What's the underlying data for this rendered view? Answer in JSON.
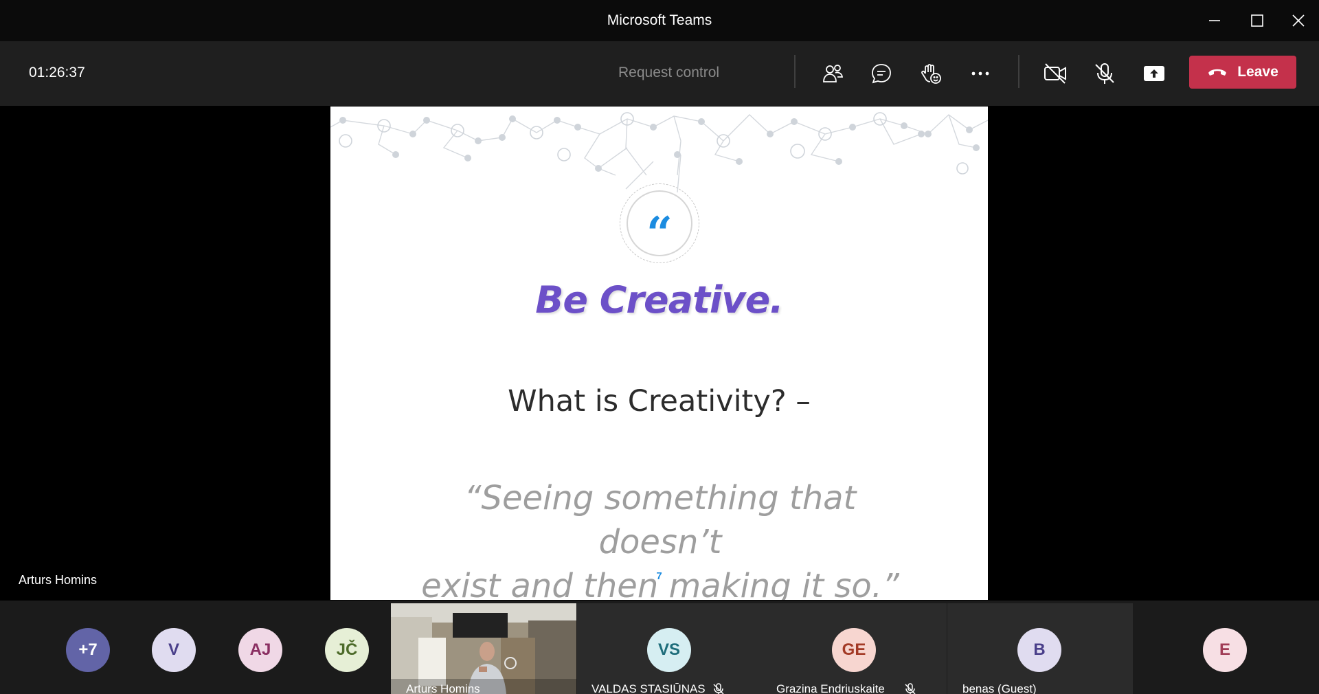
{
  "window": {
    "title": "Microsoft Teams"
  },
  "toolbar": {
    "timer": "01:26:37",
    "request_control_label": "Request control",
    "leave_label": "Leave"
  },
  "slide": {
    "quote_mark": "“",
    "heading": "Be Creative.",
    "subheading": "What is Creativity? –",
    "quote_line1": "“Seeing something that doesn’t",
    "quote_line2": "exist and then making it so.”",
    "page_number": "7"
  },
  "presenter": {
    "name": "Arturs Homins"
  },
  "participants": {
    "overflow": {
      "label": "+7",
      "bg": "#6264a7",
      "fg": "#ffffff"
    },
    "avatars": [
      {
        "initials": "V",
        "bg": "#e0dcf0",
        "fg": "#4a3f8a"
      },
      {
        "initials": "AJ",
        "bg": "#f0d8e6",
        "fg": "#8a2f62"
      },
      {
        "initials": "JČ",
        "bg": "#e6efd6",
        "fg": "#4d6b2a"
      }
    ],
    "video": {
      "name": "Arturs Homins"
    },
    "tiles": [
      {
        "initials": "VS",
        "name": "VALDAS STASIŪNAS",
        "muted": true,
        "bg": "#d6eef2",
        "fg": "#1d6c7a"
      },
      {
        "initials": "GE",
        "name": "Grazina Endriuskaite",
        "muted": true,
        "bg": "#f7d6d0",
        "fg": "#a33a26"
      },
      {
        "initials": "B",
        "name": "benas (Guest)",
        "muted": false,
        "bg": "#e0dcf0",
        "fg": "#4a3f8a"
      }
    ],
    "last": {
      "initials": "E",
      "bg": "#f7dfe4",
      "fg": "#a03b55"
    }
  },
  "colors": {
    "leave": "#c4314b",
    "accent": "#6c50c8",
    "link": "#1c8ce0"
  }
}
